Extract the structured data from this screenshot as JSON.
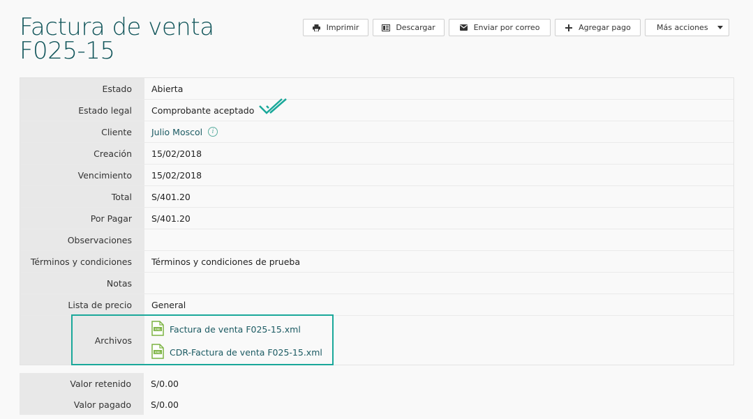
{
  "header": {
    "title_line1": "Factura de venta",
    "title_line2": "F025-15"
  },
  "toolbar": {
    "print_label": "Imprimir",
    "download_label": "Descargar",
    "email_label": "Enviar por correo",
    "add_payment_label": "Agregar pago",
    "more_actions_label": "Más acciones"
  },
  "details": {
    "estado": {
      "label": "Estado",
      "value": "Abierta"
    },
    "estado_legal": {
      "label": "Estado legal",
      "value": "Comprobante aceptado"
    },
    "cliente": {
      "label": "Cliente",
      "value": "Julio Moscol"
    },
    "creacion": {
      "label": "Creación",
      "value": "15/02/2018"
    },
    "vencimiento": {
      "label": "Vencimiento",
      "value": "15/02/2018"
    },
    "total": {
      "label": "Total",
      "value": "S/401.20"
    },
    "por_pagar": {
      "label": "Por Pagar",
      "value": "S/401.20"
    },
    "observaciones": {
      "label": "Observaciones",
      "value": ""
    },
    "terminos": {
      "label": "Términos y condiciones",
      "value": "Términos y condiciones de prueba"
    },
    "notas": {
      "label": "Notas",
      "value": ""
    },
    "lista_precio": {
      "label": "Lista de precio",
      "value": "General"
    },
    "archivos": {
      "label": "Archivos",
      "files": [
        "Factura de venta F025-15.xml",
        "CDR-Factura de venta F025-15.xml"
      ]
    }
  },
  "retention": {
    "valor_retenido": {
      "label": "Valor retenido",
      "value": "S/0.00"
    },
    "valor_pagado": {
      "label": "Valor pagado",
      "value": "S/0.00"
    }
  },
  "colors": {
    "title": "#11555a",
    "accent": "#1aa89a",
    "link": "#1b5a62",
    "file_icon": "#7cb342"
  }
}
